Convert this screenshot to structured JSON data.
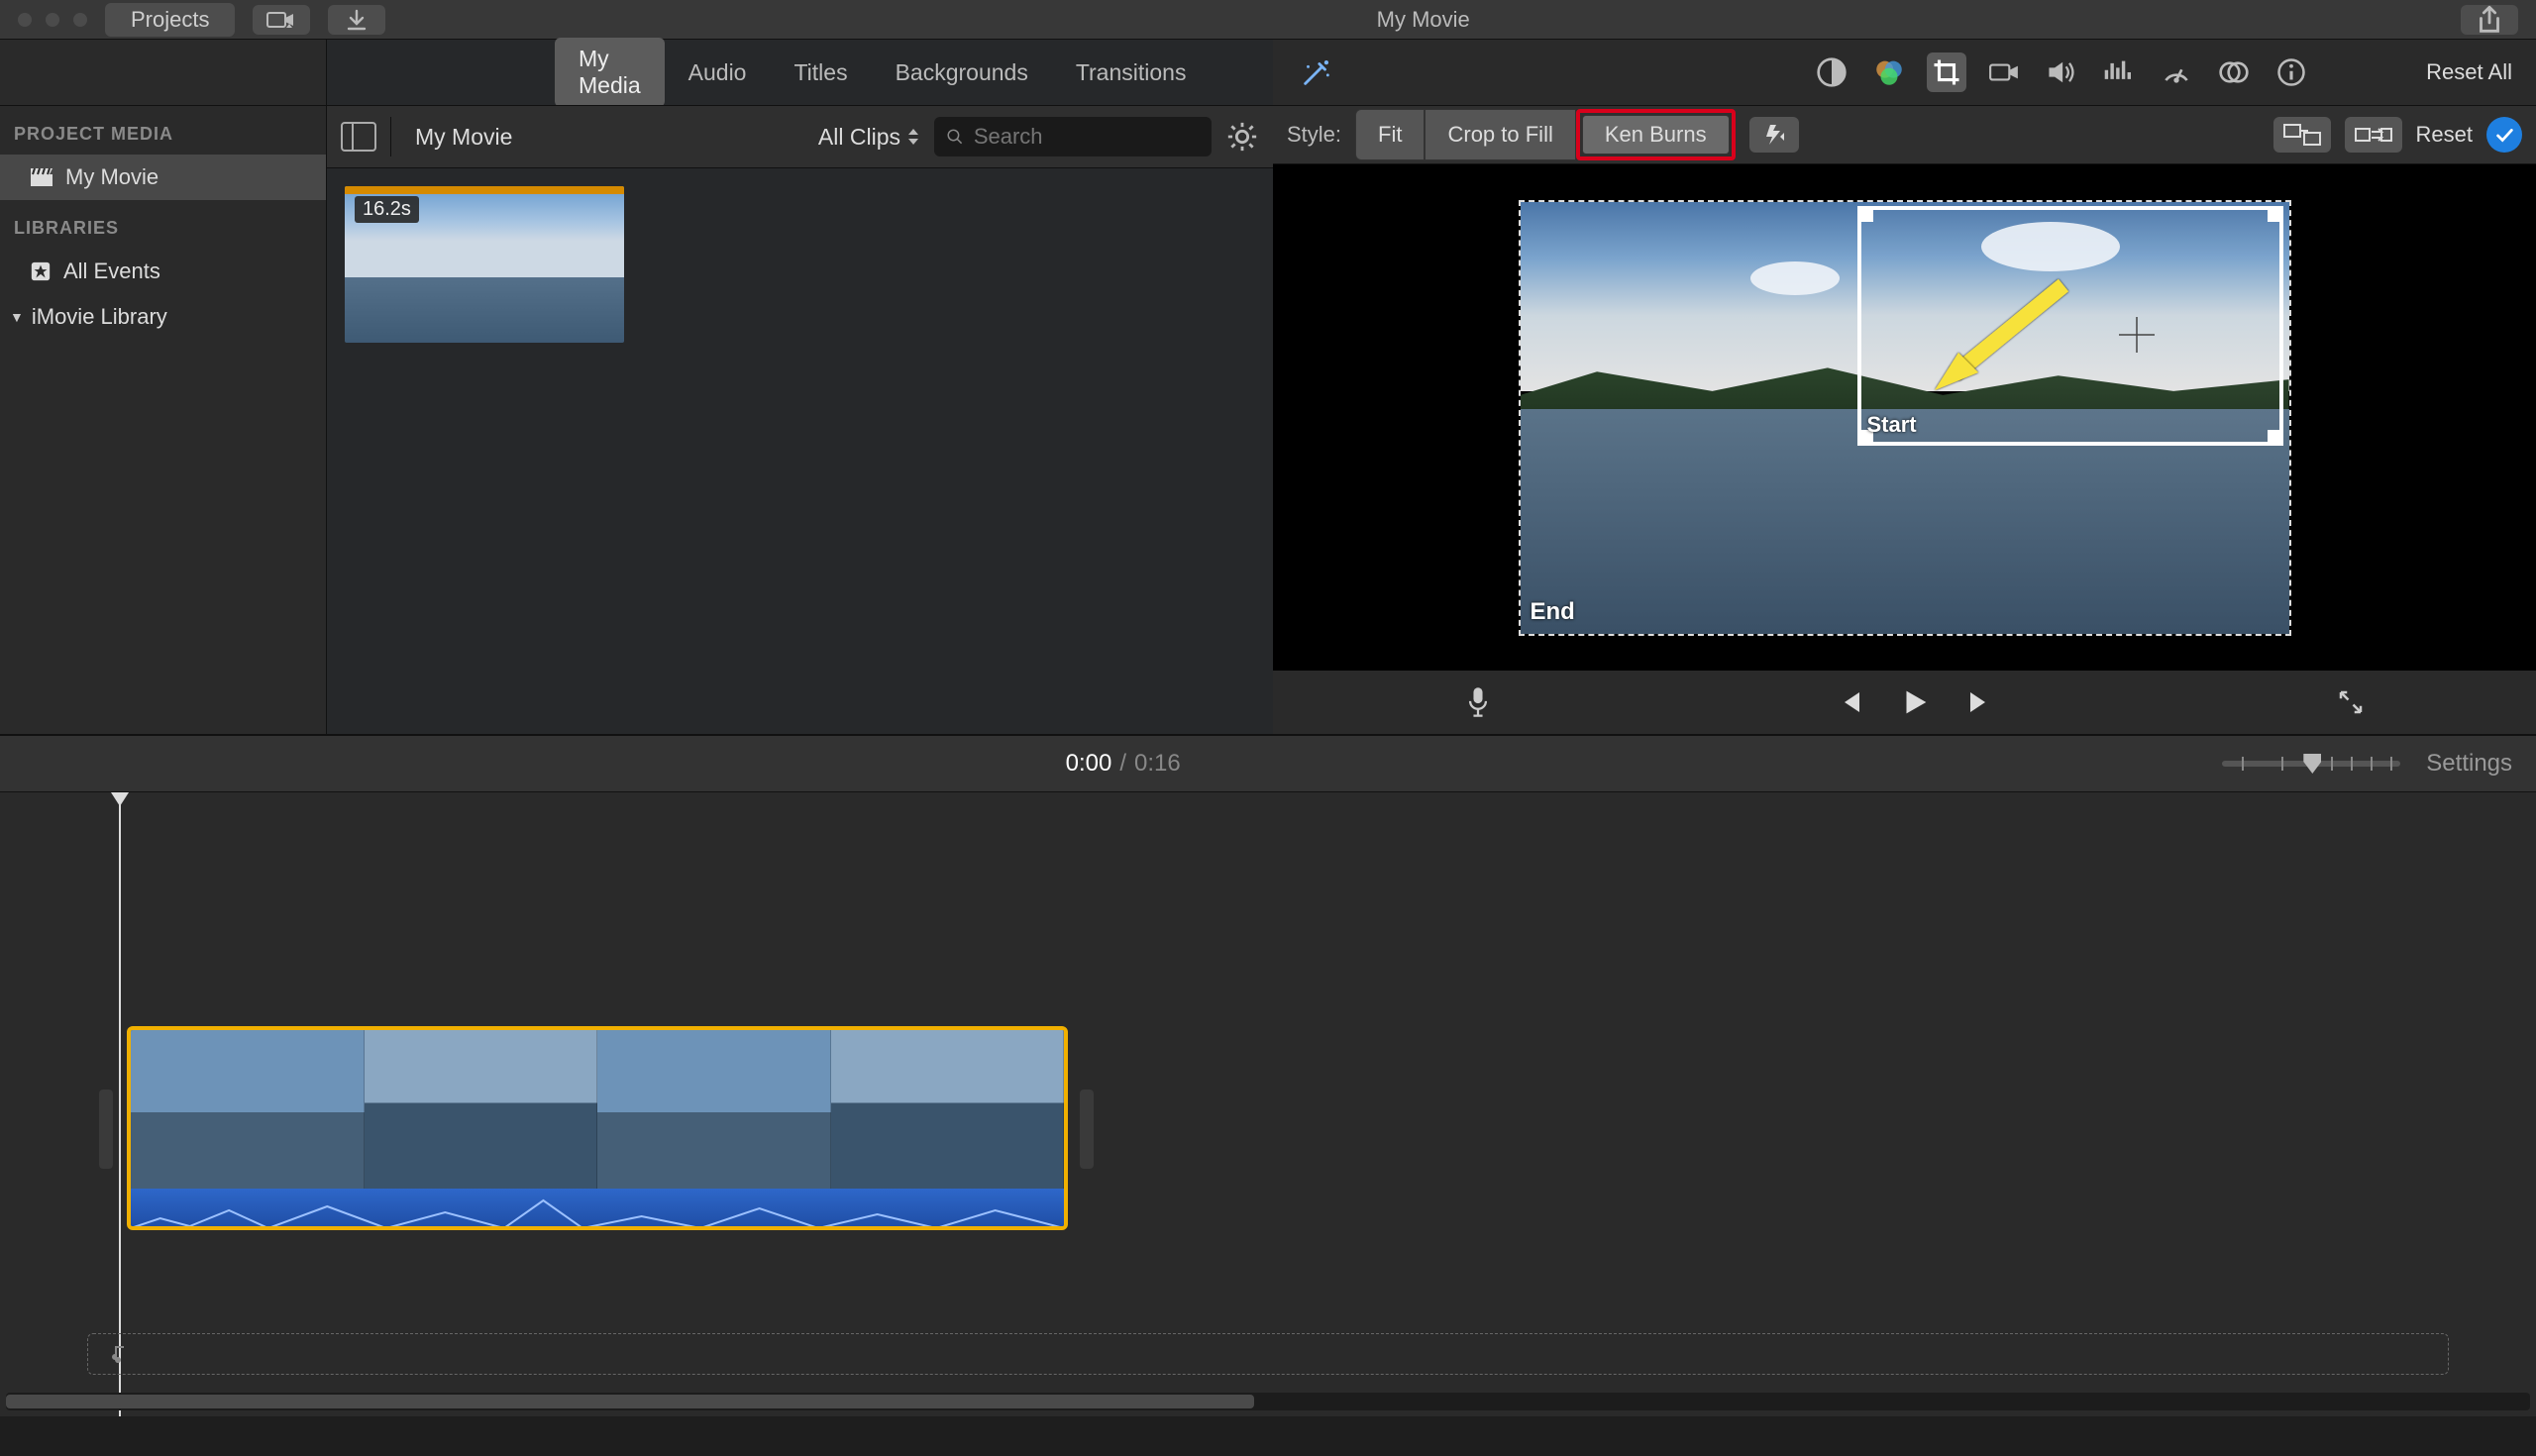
{
  "window": {
    "title": "My Movie"
  },
  "toolbar": {
    "projects_label": "Projects"
  },
  "sidebar": {
    "project_media_header": "PROJECT MEDIA",
    "libraries_header": "LIBRARIES",
    "items": {
      "my_movie": "My Movie",
      "all_events": "All Events",
      "imovie_library": "iMovie Library"
    }
  },
  "tabs": {
    "my_media": "My Media",
    "audio": "Audio",
    "titles": "Titles",
    "backgrounds": "Backgrounds",
    "transitions": "Transitions"
  },
  "browser": {
    "project_label": "My Movie",
    "filter": "All Clips",
    "search_placeholder": "Search",
    "clip_duration": "16.2s"
  },
  "viewer_toolbar": {
    "reset_all": "Reset All"
  },
  "crop_bar": {
    "style_label": "Style:",
    "fit": "Fit",
    "crop_to_fill": "Crop to Fill",
    "ken_burns": "Ken Burns",
    "reset": "Reset"
  },
  "viewer": {
    "end_label": "End",
    "start_label": "Start"
  },
  "timebar": {
    "current": "0:00",
    "separator": "/",
    "total": "0:16",
    "settings": "Settings"
  }
}
